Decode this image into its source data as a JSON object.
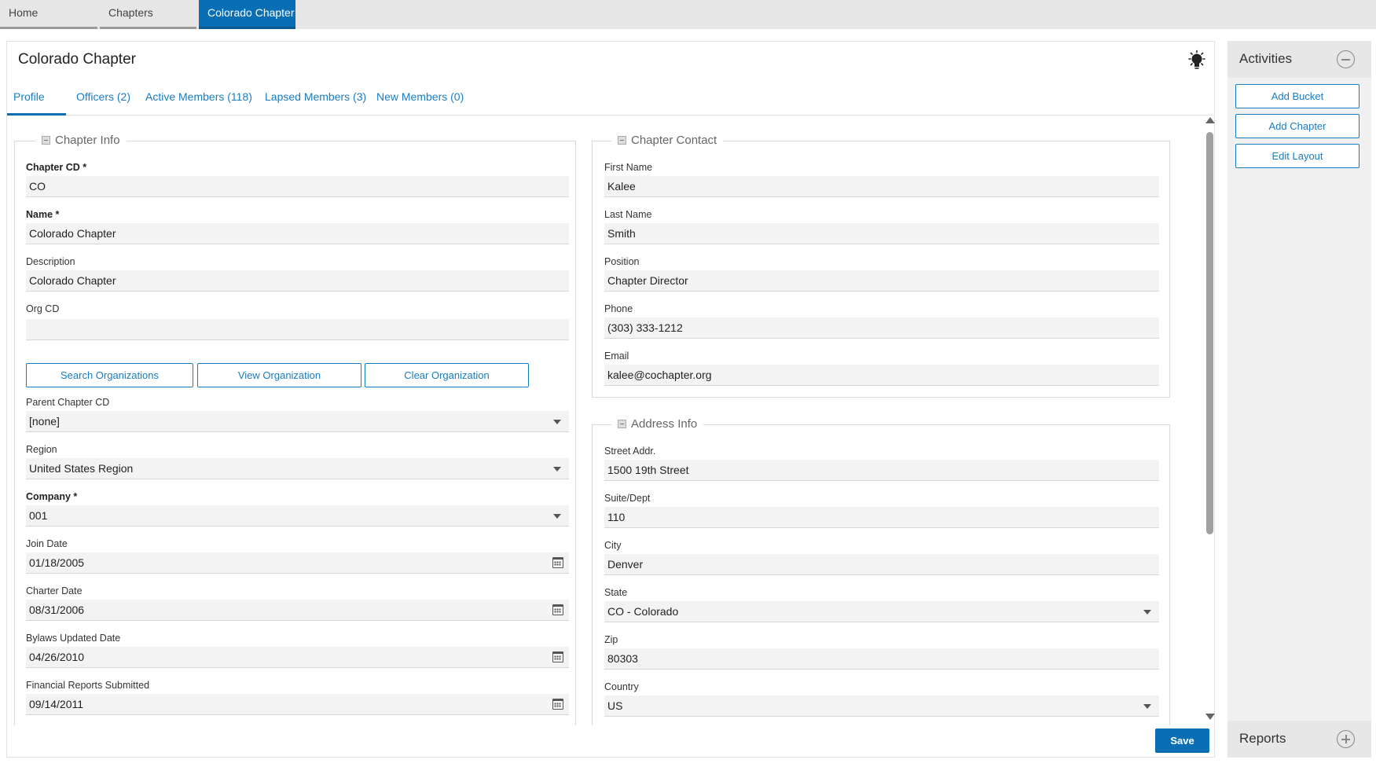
{
  "breadcrumbs": [
    "Home",
    "Chapters",
    "Colorado Chapter"
  ],
  "page": {
    "title": "Colorado Chapter",
    "bulb_icon": "lightbulb-icon"
  },
  "tabs": [
    "Profile",
    "Officers (2)",
    "Active Members (118)",
    "Lapsed Members (3)",
    "New Members (0)"
  ],
  "chapter_info": {
    "legend": "Chapter Info",
    "chapter_cd": {
      "label": "Chapter CD *",
      "value": "CO"
    },
    "name": {
      "label": "Name *",
      "value": "Colorado Chapter"
    },
    "description": {
      "label": "Description",
      "value": "Colorado Chapter"
    },
    "org_cd": {
      "label": "Org CD",
      "value": ""
    },
    "buttons": {
      "search": "Search Organizations",
      "view": "View Organization",
      "clear": "Clear Organization"
    },
    "parent_chapter_cd": {
      "label": "Parent Chapter CD",
      "value": "[none]"
    },
    "region": {
      "label": "Region",
      "value": "United States Region"
    },
    "company": {
      "label": "Company *",
      "value": "001"
    },
    "join_date": {
      "label": "Join Date",
      "value": "01/18/2005"
    },
    "charter_date": {
      "label": "Charter Date",
      "value": "08/31/2006"
    },
    "bylaws_updated_date": {
      "label": "Bylaws Updated Date",
      "value": "04/26/2010"
    },
    "financial_reports_submitted": {
      "label": "Financial Reports Submitted",
      "value": "09/14/2011"
    }
  },
  "chapter_contact": {
    "legend": "Chapter Contact",
    "first_name": {
      "label": "First Name",
      "value": "Kalee"
    },
    "last_name": {
      "label": "Last Name",
      "value": "Smith"
    },
    "position": {
      "label": "Position",
      "value": "Chapter Director"
    },
    "phone": {
      "label": "Phone",
      "value": "(303) 333-1212"
    },
    "email": {
      "label": "Email",
      "value": "kalee@cochapter.org"
    }
  },
  "address_info": {
    "legend": "Address Info",
    "street": {
      "label": "Street Addr.",
      "value": "1500 19th Street"
    },
    "suite": {
      "label": "Suite/Dept",
      "value": "110"
    },
    "city": {
      "label": "City",
      "value": "Denver"
    },
    "state": {
      "label": "State",
      "value": "CO - Colorado"
    },
    "zip": {
      "label": "Zip",
      "value": "80303"
    },
    "country": {
      "label": "Country",
      "value": "US"
    }
  },
  "save_label": "Save",
  "side": {
    "activities_title": "Activities",
    "activities_buttons": [
      "Add Bucket",
      "Add Chapter",
      "Edit Layout"
    ],
    "reports_title": "Reports"
  },
  "colors": {
    "accent": "#0a6eb4",
    "link": "#1a7cc1",
    "field_bg": "#f3f3f3"
  }
}
